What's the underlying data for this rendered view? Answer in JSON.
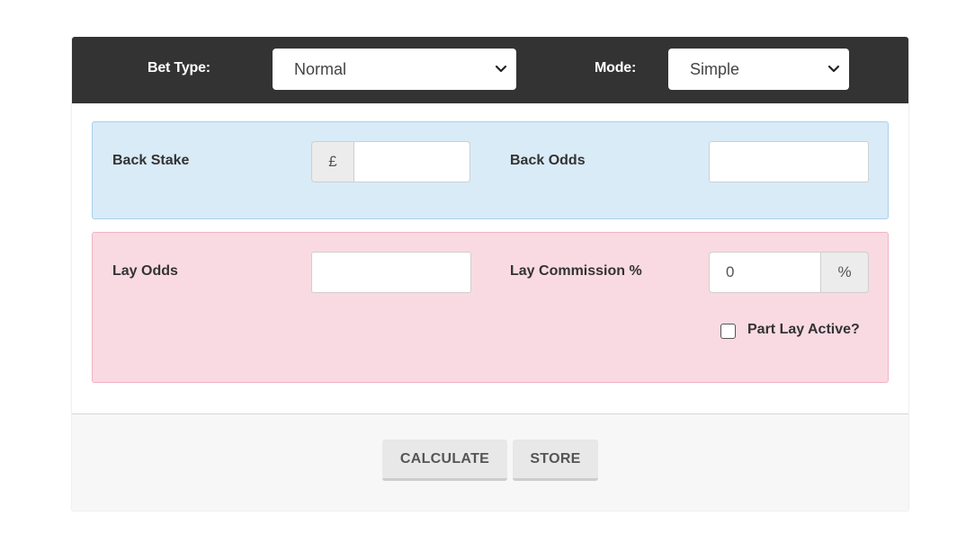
{
  "header": {
    "bet_type_label": "Bet Type:",
    "bet_type_value": "Normal",
    "mode_label": "Mode:",
    "mode_value": "Simple"
  },
  "back": {
    "stake_label": "Back Stake",
    "currency_symbol": "£",
    "stake_value": "",
    "odds_label": "Back Odds",
    "odds_value": ""
  },
  "lay": {
    "odds_label": "Lay Odds",
    "odds_value": "",
    "commission_label": "Lay Commission %",
    "commission_value": "0",
    "percent_symbol": "%",
    "part_lay_label": "Part Lay Active?",
    "part_lay_checked": false
  },
  "actions": {
    "calculate_label": "CALCULATE",
    "store_label": "STORE"
  },
  "colors": {
    "header_bg": "#333333",
    "back_panel_bg": "#d9ebf7",
    "back_panel_border": "#a9d0ea",
    "lay_panel_bg": "#f9dae3",
    "lay_panel_border": "#f2b3c4",
    "footer_bg": "#f7f7f7"
  },
  "icons": {
    "select_arrow": "chevron-down-icon"
  }
}
